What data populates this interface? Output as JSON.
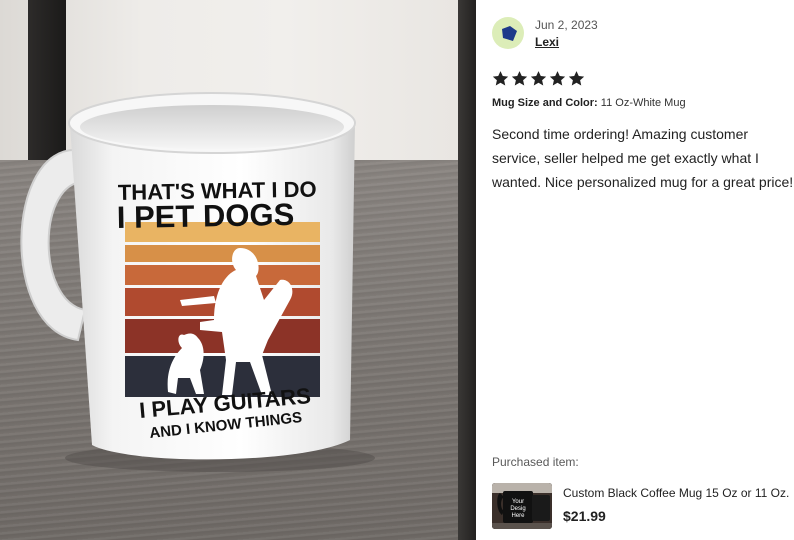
{
  "photo": {
    "mug_text_top_line1": "THAT'S WHAT I DO",
    "mug_text_top_line2": "I PET DOGS",
    "mug_text_bottom_line1": "I PLAY GUITARS",
    "mug_text_bottom_line2": "AND I KNOW THINGS"
  },
  "review": {
    "date": "Jun 2, 2023",
    "reviewer": "Lexi",
    "rating": 5,
    "meta_label": "Mug Size and Color:",
    "meta_value": "11 Oz-White Mug",
    "text": "Second time ordering! Amazing customer service, seller helped me get exactly what I wanted. Nice personalized mug for a great price!",
    "purchased_label": "Purchased item:",
    "item_title": "Custom Black Coffee Mug 15 Oz or 11 Oz.",
    "item_price": "$21.99",
    "item_thumb_text": "Your Design Here"
  },
  "colors": {
    "avatar_bg": "#dcedb8",
    "avatar_shape": "#1e3a8a",
    "star": "#222222"
  }
}
